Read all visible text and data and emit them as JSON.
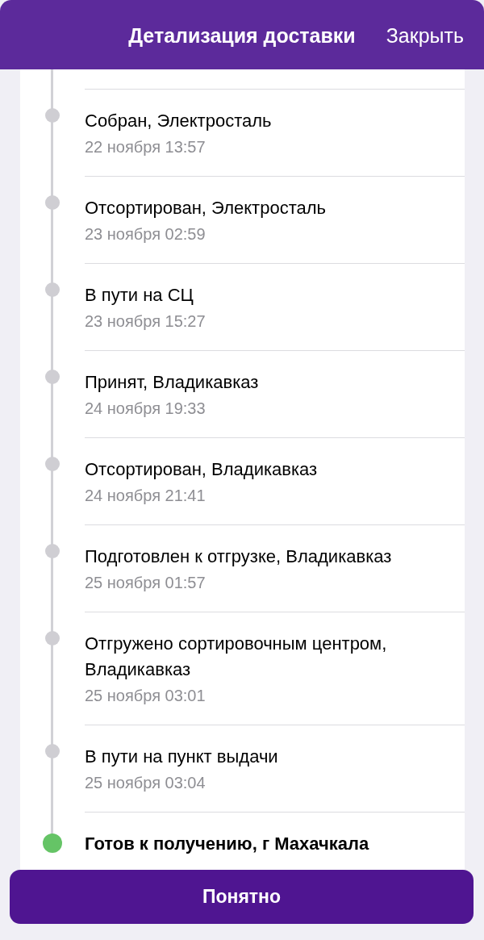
{
  "header": {
    "title": "Детализация доставки",
    "close": "Закрыть"
  },
  "events": [
    {
      "title": "Собран, Электросталь",
      "time": "22 ноября 13:57",
      "color": "#cfced3",
      "current": false
    },
    {
      "title": "Отсортирован, Электросталь",
      "time": "23 ноября 02:59",
      "color": "#cfced3",
      "current": false
    },
    {
      "title": "В пути на СЦ",
      "time": "23 ноября 15:27",
      "color": "#cfced3",
      "current": false
    },
    {
      "title": "Принят, Владикавказ",
      "time": "24 ноября 19:33",
      "color": "#cfced3",
      "current": false
    },
    {
      "title": "Отсортирован, Владикавказ",
      "time": "24 ноября 21:41",
      "color": "#cfced3",
      "current": false
    },
    {
      "title": "Подготовлен к отгрузке, Владикавказ",
      "time": "25 ноября 01:57",
      "color": "#cfced3",
      "current": false
    },
    {
      "title": "Отгружено сортировочным центром, Владикавказ",
      "time": "25 ноября 03:01",
      "color": "#cfced3",
      "current": false
    },
    {
      "title": "В пути на пункт выдачи",
      "time": "25 ноября 03:04",
      "color": "#cfced3",
      "current": false
    },
    {
      "title": "Готов к получению, г Махачкала",
      "color": "#65c466",
      "current": true
    }
  ],
  "button": {
    "label": "Понятно"
  }
}
